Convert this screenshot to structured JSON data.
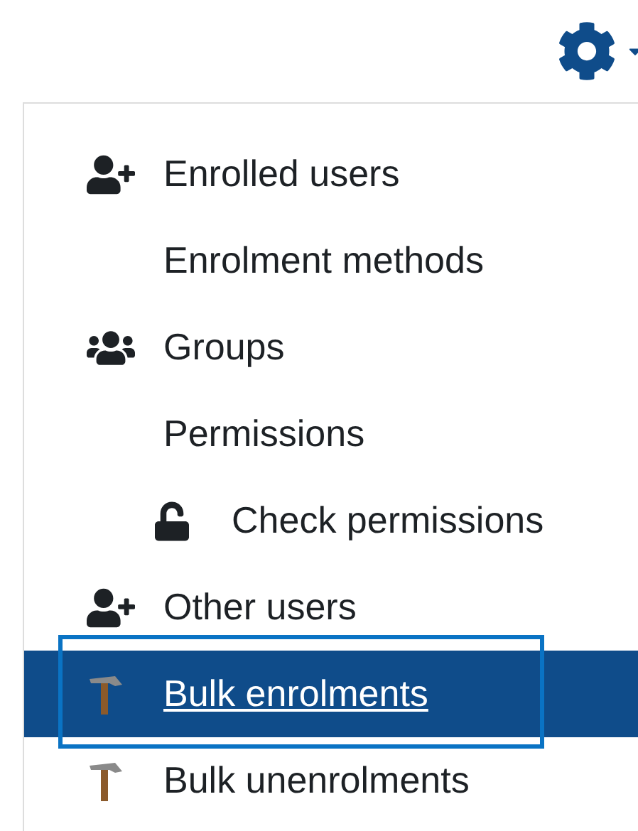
{
  "menu_items": [
    {
      "label": "Enrolled users",
      "kind": "user-plus",
      "selected": false,
      "outlined": false
    },
    {
      "label": "Enrolment methods",
      "kind": "plain",
      "selected": false,
      "outlined": false
    },
    {
      "label": "Groups",
      "kind": "users",
      "selected": false,
      "outlined": false
    },
    {
      "label": "Permissions",
      "kind": "plain",
      "selected": false,
      "outlined": false,
      "children": [
        {
          "label": "Check permissions",
          "kind": "lock",
          "selected": false,
          "outlined": false
        }
      ]
    },
    {
      "label": "Other users",
      "kind": "user-plus",
      "selected": false,
      "outlined": false
    },
    {
      "label": "Bulk enrolments",
      "kind": "hammer",
      "selected": true,
      "outlined": true
    },
    {
      "label": "Bulk unenrolments",
      "kind": "hammer",
      "selected": false,
      "outlined": false
    }
  ]
}
